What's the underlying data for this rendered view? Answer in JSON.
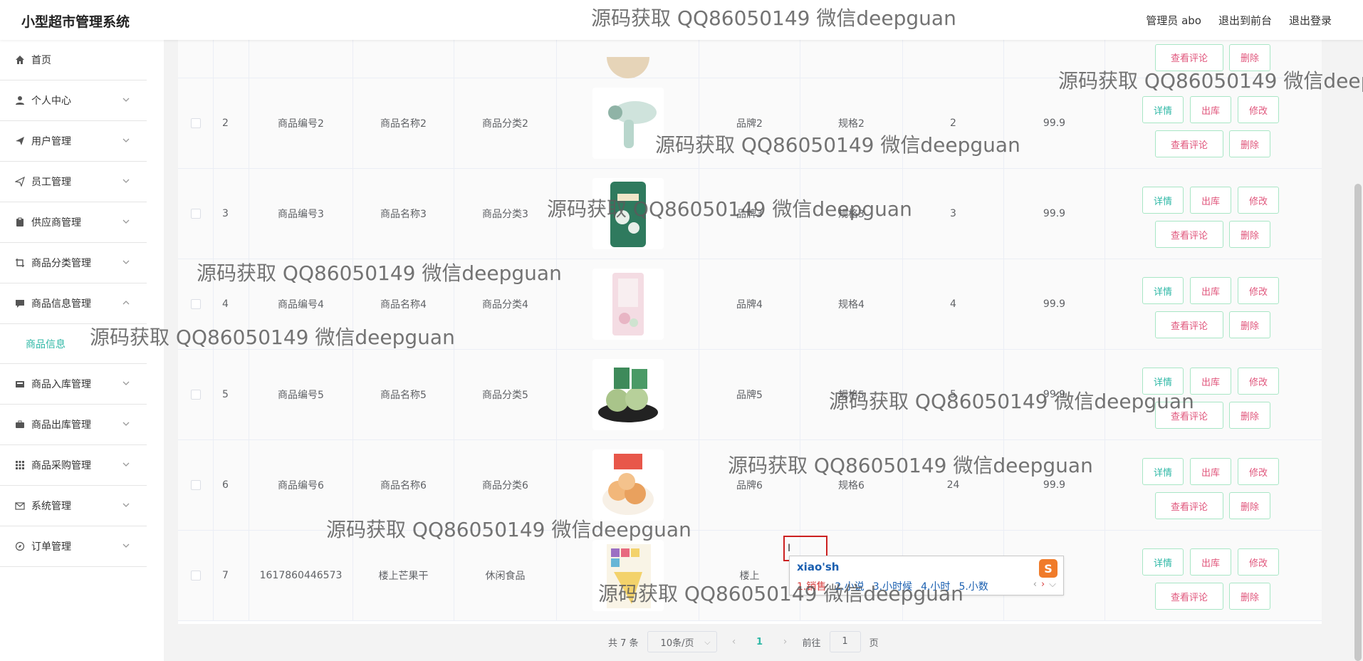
{
  "header": {
    "title": "小型超市管理系统",
    "user": "管理员 abo",
    "front": "退出到前台",
    "logout": "退出登录"
  },
  "sidebar": {
    "items": [
      {
        "label": "首页",
        "icon": "home-icon"
      },
      {
        "label": "个人中心",
        "icon": "user-icon"
      },
      {
        "label": "用户管理",
        "icon": "send-icon"
      },
      {
        "label": "员工管理",
        "icon": "paper-plane-icon"
      },
      {
        "label": "供应商管理",
        "icon": "clipboard-icon"
      },
      {
        "label": "商品分类管理",
        "icon": "crop-icon"
      },
      {
        "label": "商品信息管理",
        "icon": "chat-icon"
      },
      {
        "label": "商品入库管理",
        "icon": "inbox-icon"
      },
      {
        "label": "商品出库管理",
        "icon": "briefcase-icon"
      },
      {
        "label": "商品采购管理",
        "icon": "grid-icon"
      },
      {
        "label": "系统管理",
        "icon": "mail-icon"
      },
      {
        "label": "订单管理",
        "icon": "compass-icon"
      }
    ],
    "sub_active": "商品信息"
  },
  "ops": {
    "detail": "详情",
    "out": "出库",
    "edit": "修改",
    "review": "查看评论",
    "delete": "删除"
  },
  "rows": [
    {
      "idx": "2",
      "code": "商品编号2",
      "name": "商品名称2",
      "category": "商品分类2",
      "brand": "品牌2",
      "spec": "规格2",
      "qty": "2",
      "price": "99.9",
      "img_color": "#cfe3dc"
    },
    {
      "idx": "3",
      "code": "商品编号3",
      "name": "商品名称3",
      "category": "商品分类3",
      "brand": "品牌3",
      "spec": "规格3",
      "qty": "3",
      "price": "99.9",
      "img_color": "#2f7a5e"
    },
    {
      "idx": "4",
      "code": "商品编号4",
      "name": "商品名称4",
      "category": "商品分类4",
      "brand": "品牌4",
      "spec": "规格4",
      "qty": "4",
      "price": "99.9",
      "img_color": "#e8b5c4"
    },
    {
      "idx": "5",
      "code": "商品编号5",
      "name": "商品名称5",
      "category": "商品分类5",
      "brand": "品牌5",
      "spec": "规格5",
      "qty": "5",
      "price": "99.9",
      "img_color": "#a9c48a"
    },
    {
      "idx": "6",
      "code": "商品编号6",
      "name": "商品名称6",
      "category": "商品分类6",
      "brand": "品牌6",
      "spec": "规格6",
      "qty": "24",
      "price": "99.9",
      "img_color": "#f2b77a"
    },
    {
      "idx": "7",
      "code": "1617860446573",
      "name": "楼上芒果干",
      "category": "休闲食品",
      "brand": "楼上",
      "spec": "",
      "qty": "",
      "price": "",
      "img_color": "#f3d26b"
    }
  ],
  "pagination": {
    "total": "共 7 条",
    "page_size": "10条/页",
    "prev": "‹",
    "current": "1",
    "next": "›",
    "goto": "前往",
    "goto_value": "1",
    "page_unit": "页"
  },
  "ime": {
    "input": "xiao'sh",
    "candidates": [
      "1.销售",
      "2.小说",
      "3.小时候",
      "4.小时",
      "5.小数"
    ],
    "logo": "S"
  },
  "watermark": "源码获取 QQ86050149 微信deepguan"
}
